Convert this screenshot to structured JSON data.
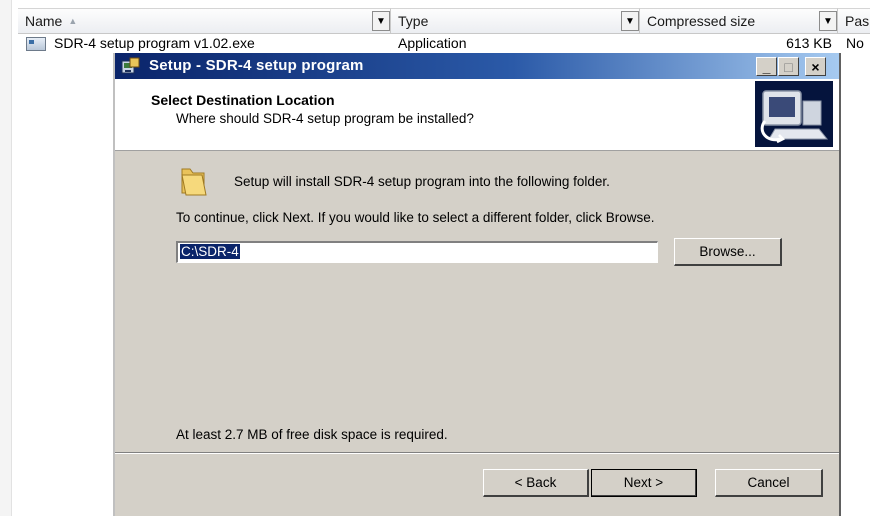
{
  "explorer": {
    "columns": {
      "name": "Name",
      "type": "Type",
      "compressed_size": "Compressed size",
      "password": "Pas"
    },
    "file": {
      "name": "SDR-4 setup program v1.02.exe",
      "type": "Application",
      "compressed_size": "613 KB",
      "password": "No"
    }
  },
  "dialog": {
    "title": "Setup - SDR-4 setup program",
    "header_title": "Select Destination Location",
    "header_subtitle": "Where should SDR-4 setup program be installed?",
    "install_text": "Setup will install SDR-4 setup program into the following folder.",
    "continue_text": "To continue, click Next. If you would like to select a different folder, click Browse.",
    "path_value": "C:\\SDR-4",
    "browse_label": "Browse...",
    "space_text": "At least 2.7 MB of free disk space is required.",
    "back_label": "< Back",
    "next_label": "Next >",
    "cancel_label": "Cancel",
    "minimize_glyph": "_",
    "maximize_glyph": "□",
    "close_glyph": "×"
  },
  "colors": {
    "titlebar_start": "#0a246a",
    "titlebar_end": "#a6caf0",
    "dialog_face": "#d4d0c8",
    "selection": "#0a246a"
  }
}
